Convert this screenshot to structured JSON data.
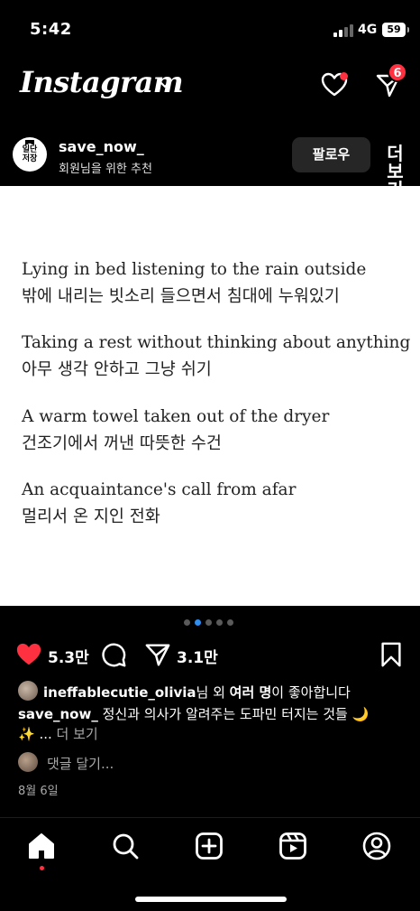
{
  "status_bar": {
    "time": "5:42",
    "network": "4G",
    "battery": "59"
  },
  "header": {
    "logo": "Instagram",
    "dm_badge_count": "6"
  },
  "post": {
    "username": "save_now_",
    "subtitle": "회원님을 위한 추천",
    "follow_label": "팔로우",
    "more_label": "더 보기",
    "avatar_text_1": "일단",
    "avatar_text_2": "저장",
    "image_lines": [
      "Lying in bed listening to the rain outside",
      "밖에 내리는 빗소리 들으면서 침대에 누워있기",
      "Taking a rest without thinking about anything",
      "아무 생각 안하고 그냥 쉬기",
      "A warm towel taken out of the dryer",
      "건조기에서 꺼낸 따뜻한 수건",
      "An acquaintance's call from afar",
      "멀리서 온 지인 전화"
    ],
    "carousel": {
      "count": 5,
      "active_index": 1
    },
    "likes": "5.3만",
    "shares": "3.1만",
    "liked_by_user": "ineffablecutie_olivia",
    "liked_by_mid": "님 외 ",
    "liked_by_bold": "여러 명",
    "liked_by_tail": "이 좋아합니다",
    "caption_user": "save_now_",
    "caption_text": " 정신과 의사가 알려주는 도파민 터지는 것들 🌙",
    "caption_text2": "✨ ... ",
    "comment_placeholder": "댓글 달기...",
    "date": "8월 6일"
  },
  "colors": {
    "accent_red": "#ff3040",
    "accent_blue": "#2e8ff0",
    "like_red": "#ff3040"
  },
  "bottom_nav": [
    "home-icon",
    "search-icon",
    "create-icon",
    "reels-icon",
    "profile-icon"
  ]
}
